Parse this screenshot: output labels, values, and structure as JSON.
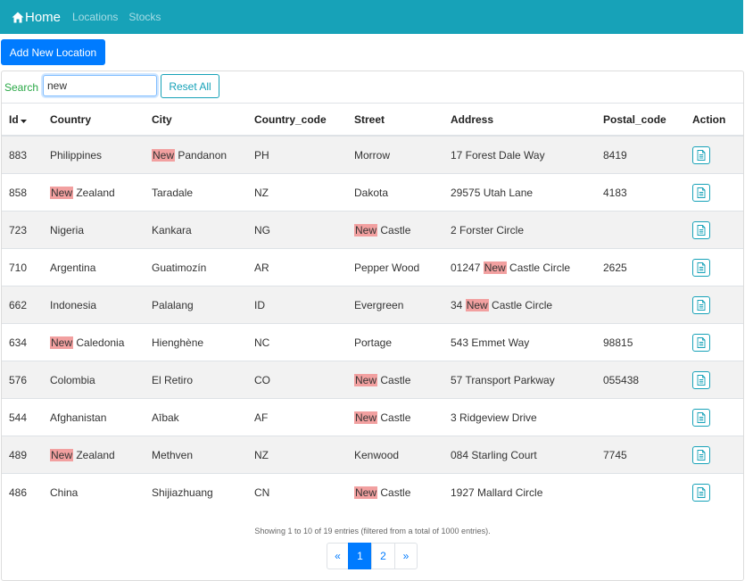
{
  "navbar": {
    "brand": "Home",
    "links": [
      "Locations",
      "Stocks"
    ]
  },
  "add_button": "Add New Location",
  "search": {
    "label": "Search",
    "value": "new",
    "reset_label": "Reset All"
  },
  "table": {
    "highlight_term": "New",
    "columns": [
      "Id",
      "Country",
      "City",
      "Country_code",
      "Street",
      "Address",
      "Postal_code",
      "Action"
    ],
    "sort_column": "Id",
    "sort_direction": "descending",
    "rows": [
      {
        "id": "883",
        "country": "Philippines",
        "city": "New Pandanon",
        "country_code": "PH",
        "street": "Morrow",
        "address": "17 Forest Dale Way",
        "postal_code": "8419"
      },
      {
        "id": "858",
        "country": "New Zealand",
        "city": "Taradale",
        "country_code": "NZ",
        "street": "Dakota",
        "address": "29575 Utah Lane",
        "postal_code": "4183"
      },
      {
        "id": "723",
        "country": "Nigeria",
        "city": "Kankara",
        "country_code": "NG",
        "street": "New Castle",
        "address": "2 Forster Circle",
        "postal_code": ""
      },
      {
        "id": "710",
        "country": "Argentina",
        "city": "Guatimozín",
        "country_code": "AR",
        "street": "Pepper Wood",
        "address": "01247 New Castle Circle",
        "postal_code": "2625"
      },
      {
        "id": "662",
        "country": "Indonesia",
        "city": "Palalang",
        "country_code": "ID",
        "street": "Evergreen",
        "address": "34 New Castle Circle",
        "postal_code": ""
      },
      {
        "id": "634",
        "country": "New Caledonia",
        "city": "Hienghène",
        "country_code": "NC",
        "street": "Portage",
        "address": "543 Emmet Way",
        "postal_code": "98815"
      },
      {
        "id": "576",
        "country": "Colombia",
        "city": "El Retiro",
        "country_code": "CO",
        "street": "New Castle",
        "address": "57 Transport Parkway",
        "postal_code": "055438"
      },
      {
        "id": "544",
        "country": "Afghanistan",
        "city": "Aībak",
        "country_code": "AF",
        "street": "New Castle",
        "address": "3 Ridgeview Drive",
        "postal_code": ""
      },
      {
        "id": "489",
        "country": "New Zealand",
        "city": "Methven",
        "country_code": "NZ",
        "street": "Kenwood",
        "address": "084 Starling Court",
        "postal_code": "7745"
      },
      {
        "id": "486",
        "country": "China",
        "city": "Shijiazhuang",
        "country_code": "CN",
        "street": "New Castle",
        "address": "1927 Mallard Circle",
        "postal_code": ""
      }
    ]
  },
  "footer": {
    "info": "Showing 1 to 10 of 19 entries (filtered from a total of 1000 entries).",
    "pagination": {
      "prev": "«",
      "pages": [
        "1",
        "2"
      ],
      "current": "1",
      "next": "»"
    }
  },
  "colors": {
    "navbar": "#17a2b8",
    "primary": "#007bff",
    "highlight": "#f2a0a0",
    "search_label": "#28a745"
  },
  "icons": {
    "brand": "home-icon",
    "sort": "caret-down-icon",
    "row_action": "document-icon"
  }
}
